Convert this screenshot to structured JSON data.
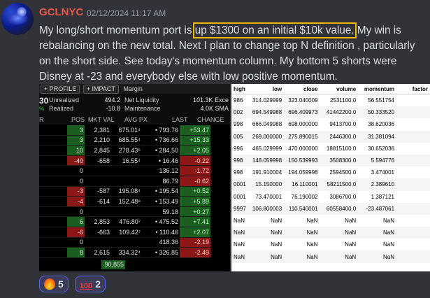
{
  "message": {
    "username": "GCLNYC",
    "timestamp": "02/12/2024 11:17 AM",
    "text_before": "My long/short momentum port is ",
    "text_highlight": "up $1300 on an initial $10k value.",
    "text_after": " My win is rebalancing on the new total.  Next I plan to change top N definition , particularly on the short side.  See today's momentum column.  My bottom 5 shorts were Disney at -23 and everybody else with low positive momentum."
  },
  "broker": {
    "tabs": [
      "+ PROFILE",
      "+ IMPACT"
    ],
    "tab_plain": "Margin",
    "account": {
      "left_big": "30",
      "left_pct": "%",
      "row1": {
        "label1": "Unrealized",
        "value1": "494.2",
        "label2": "Net Liquidity",
        "value2": "101.3K",
        "extra": "Exce"
      },
      "row2": {
        "label1": "Realized",
        "value1": "-10.8",
        "label2": "Maintenance",
        "value2": "4.0K",
        "extra": "SMA"
      }
    },
    "columns": [
      "R",
      "POS",
      "MKT VAL",
      "AVG PX",
      "LAST",
      "CHANGE"
    ],
    "rows": [
      {
        "pos": "3",
        "mv": "2,381",
        "avg": "675.01⁴",
        "last": "• 793.76",
        "chg": "+53.47",
        "pos_sign": "pos",
        "chg_sign": "pos"
      },
      {
        "pos": "3",
        "mv": "2,210",
        "avg": "685.55⁴",
        "last": "• 736.66",
        "chg": "+15.33",
        "pos_sign": "pos",
        "chg_sign": "pos"
      },
      {
        "pos": "10",
        "mv": "2,845",
        "avg": "278.43⁵",
        "last": "• 284.50",
        "chg": "+2.05",
        "pos_sign": "pos",
        "chg_sign": "pos"
      },
      {
        "pos": "-40",
        "mv": "-658",
        "avg": "16.55⁴",
        "last": "• 16.46",
        "chg": "-0.22",
        "pos_sign": "neg",
        "chg_sign": "neg"
      },
      {
        "pos": "0",
        "mv": "",
        "avg": "",
        "last": "136.12",
        "chg": "-1.72",
        "pos_sign": "none",
        "chg_sign": "neg"
      },
      {
        "pos": "0",
        "mv": "",
        "avg": "",
        "last": "86.79",
        "chg": "-0.62",
        "pos_sign": "none",
        "chg_sign": "neg"
      },
      {
        "pos": "-3",
        "mv": "-587",
        "avg": "195.08⁴",
        "last": "• 195.54",
        "chg": "+0.52",
        "pos_sign": "neg",
        "chg_sign": "pos"
      },
      {
        "pos": "-4",
        "mv": "-614",
        "avg": "152.48⁸",
        "last": "• 153.49",
        "chg": "+5.89",
        "pos_sign": "neg",
        "chg_sign": "pos"
      },
      {
        "pos": "0",
        "mv": "",
        "avg": "",
        "last": "59.18",
        "chg": "+0.27",
        "pos_sign": "none",
        "chg_sign": "pos"
      },
      {
        "pos": "6",
        "mv": "2,853",
        "avg": "476.80⁷",
        "last": "• 475.52",
        "chg": "+7.41",
        "pos_sign": "pos",
        "chg_sign": "pos"
      },
      {
        "pos": "-6",
        "mv": "-663",
        "avg": "109.42⁷",
        "last": "• 110.46",
        "chg": "+2.07",
        "pos_sign": "neg",
        "chg_sign": "pos"
      },
      {
        "pos": "0",
        "mv": "",
        "avg": "",
        "last": "418.36",
        "chg": "-2.19",
        "pos_sign": "none",
        "chg_sign": "neg"
      },
      {
        "pos": "8",
        "mv": "2,615",
        "avg": "334.32⁴",
        "last": "• 326.85",
        "chg": "-2.49",
        "pos_sign": "pos",
        "chg_sign": "neg"
      }
    ],
    "total_mkt_val": "90,855"
  },
  "dataframe": {
    "columns": [
      "high",
      "low",
      "close",
      "volume",
      "momentum",
      "factor"
    ],
    "rows": [
      [
        "986",
        "314.029999",
        "323.040009",
        "2531100.0",
        "56.551754",
        ""
      ],
      [
        "002",
        "694.549988",
        "696.409973",
        "41442200.0",
        "50.333520",
        ""
      ],
      [
        "998",
        "666.049988",
        "698.000000",
        "9413700.0",
        "38.620036",
        ""
      ],
      [
        "005",
        "269.000000",
        "275.890015",
        "2446300.0",
        "31.381094",
        ""
      ],
      [
        "996",
        "465.029999",
        "470.000000",
        "18815100.0",
        "30.652036",
        ""
      ],
      [
        "998",
        "148.059998",
        "150.539993",
        "3508300.0",
        "5.594776",
        ""
      ],
      [
        "998",
        "191.910004",
        "194.059998",
        "2594500.0",
        "3.474001",
        ""
      ],
      [
        "0001",
        "15.150000",
        "16.110001",
        "58211500.0",
        "2.389610",
        ""
      ],
      [
        "0001",
        "73.470001",
        "76.190002",
        "3086700.0",
        "1.387121",
        ""
      ],
      [
        "9997",
        "106.800003",
        "110.540001",
        "60558400.0",
        "-23.487061",
        ""
      ],
      [
        "NaN",
        "NaN",
        "NaN",
        "NaN",
        "NaN",
        ""
      ],
      [
        "NaN",
        "NaN",
        "NaN",
        "NaN",
        "NaN",
        ""
      ],
      [
        "NaN",
        "NaN",
        "NaN",
        "NaN",
        "NaN",
        ""
      ],
      [
        "NaN",
        "NaN",
        "NaN",
        "NaN",
        "NaN",
        ""
      ]
    ]
  },
  "reactions": [
    {
      "icon": "fire-icon",
      "count": "5"
    },
    {
      "icon": "hundred-points-icon",
      "label": "100",
      "count": "2"
    }
  ],
  "colors": {
    "username": "#e8574b",
    "highlight_outline": "#f0b400",
    "positive_cell": "#1c5e20",
    "negative_cell": "#8b1717"
  }
}
